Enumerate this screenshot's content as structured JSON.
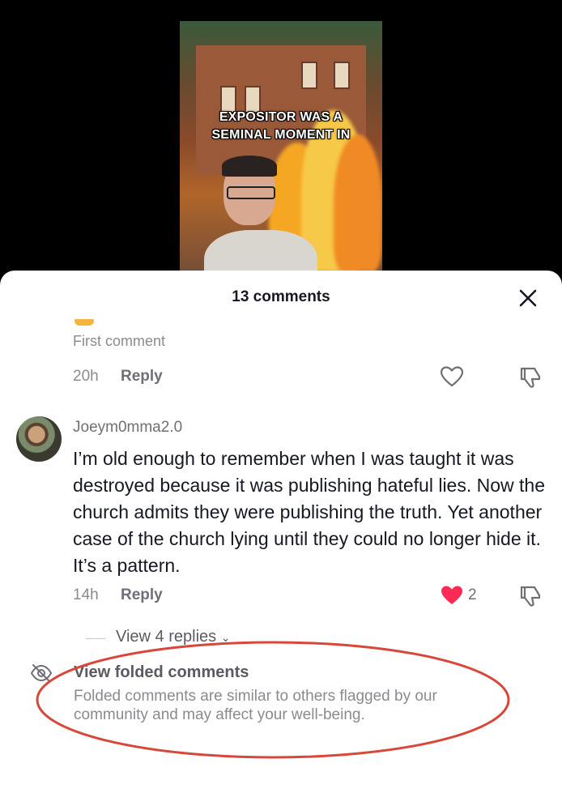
{
  "video": {
    "caption_line1": "EXPOSITOR WAS A",
    "caption_line2": "SEMINAL MOMENT IN"
  },
  "sheet": {
    "title": "13 comments"
  },
  "comments": [
    {
      "text": "First comment",
      "time": "20h",
      "reply_label": "Reply"
    },
    {
      "username": "Joeym0mma2.0",
      "text": "I’m old enough to remember when I was taught it was destroyed because it was publishing hateful lies. Now the church admits they were publishing the truth. Yet another case of the church lying until they could no longer hide it. It’s a pattern.",
      "time": "14h",
      "reply_label": "Reply",
      "likes": "2",
      "view_replies": "View 4 replies"
    }
  ],
  "folded": {
    "title": "View folded comments",
    "description": "Folded comments are similar to others flagged by our community and may affect your well-being."
  },
  "colors": {
    "like_active": "#fe2c55",
    "annotation": "#d9473b"
  }
}
